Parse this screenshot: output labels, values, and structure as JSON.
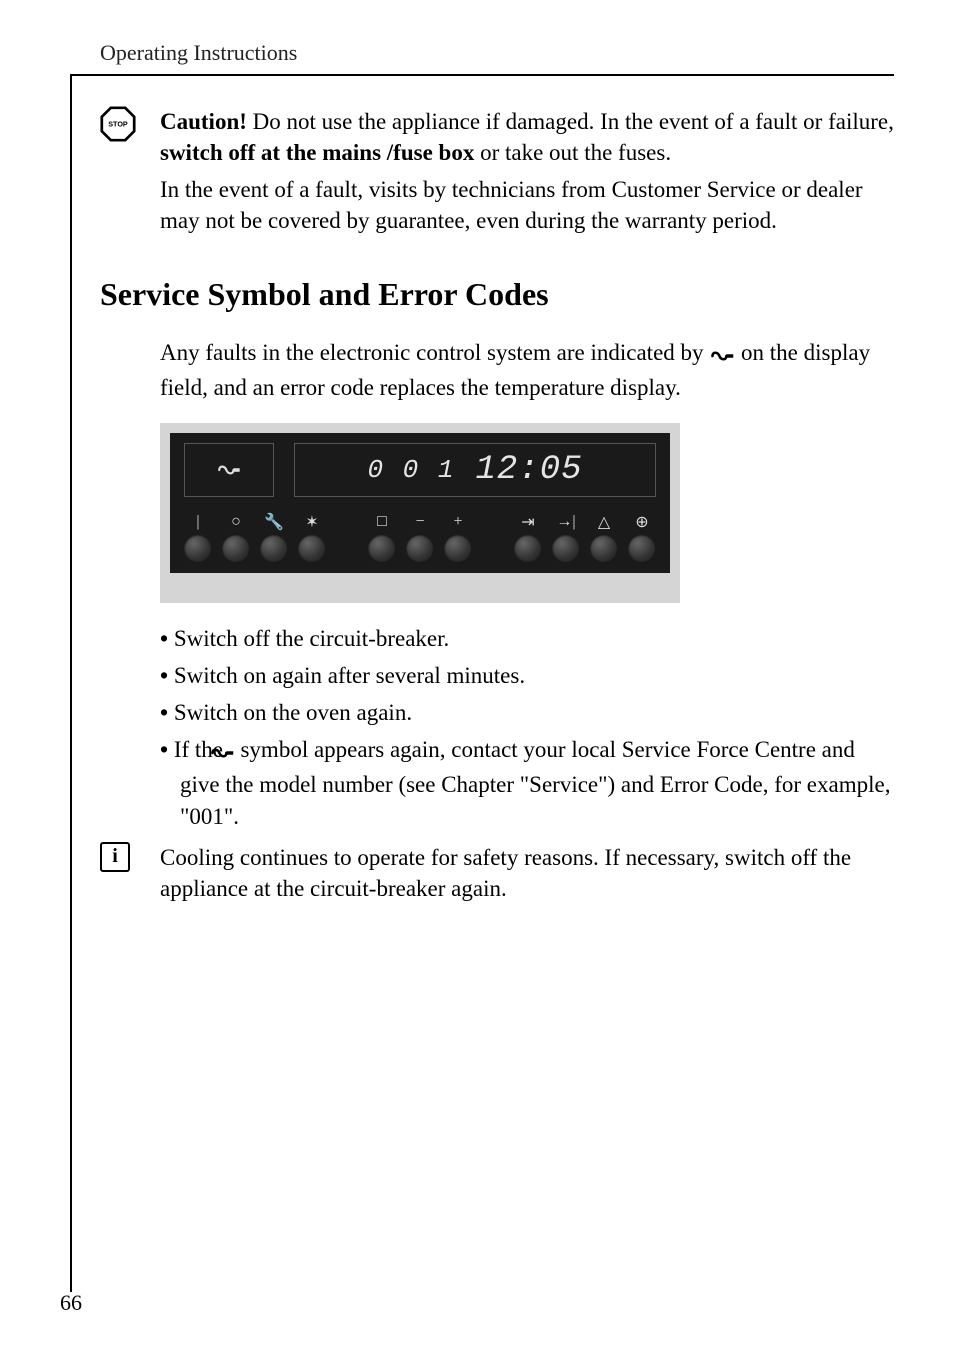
{
  "header": "Operating Instructions",
  "caution": {
    "lead": "Caution!",
    "p1a": " Do not use the appliance if damaged. In the event of a fault or failure, ",
    "p1b": "switch off at the mains /fuse box",
    "p1c": " or take out the fuses.",
    "p2": "In the event of a fault, visits by technicians from Customer Service or dealer may not be covered by guarantee, even during the warranty period."
  },
  "section_heading": "Service Symbol and Error Codes",
  "intro": {
    "a": "Any faults in the electronic control system are indicated by ",
    "b": " on the display field, and an error code replaces the temperature display."
  },
  "display": {
    "error_code": "0 0 1",
    "clock": "12:05"
  },
  "panel_buttons": {
    "g1": [
      "|",
      "○",
      "🔧",
      "✶"
    ],
    "g2": [
      "□",
      "−",
      "+"
    ],
    "g3": [
      "⇥",
      "→|",
      "△",
      "⊕"
    ]
  },
  "steps": {
    "s1": "Switch off the circuit-breaker.",
    "s2": "Switch on again after several minutes.",
    "s3": "Switch on the oven again.",
    "s4a": "If the ",
    "s4b": " symbol appears again, contact your local Service Force Centre and give the model number (see Chapter \"Service\") and Error Code, for example, \"001\"."
  },
  "info_note": "Cooling continues to operate for safety reasons. If necessary, switch off the appliance at the circuit-breaker again.",
  "page_number": "66",
  "icons": {
    "stop": "STOP",
    "info": "i"
  }
}
